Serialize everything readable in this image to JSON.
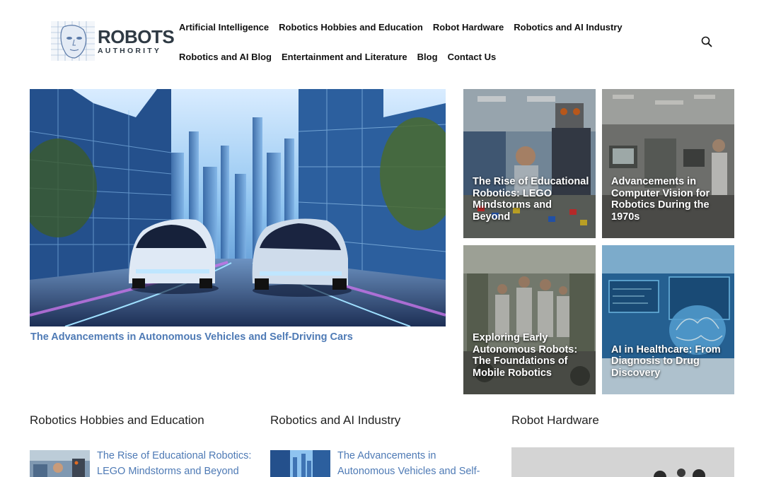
{
  "logo": {
    "title": "ROBOTS",
    "subtitle": "AUTHORITY"
  },
  "nav": {
    "row1": [
      "Artificial Intelligence",
      "Robotics Hobbies and Education",
      "Robot Hardware",
      "Robotics and AI Industry"
    ],
    "row2": [
      "Robotics and AI Blog",
      "Entertainment and Literature",
      "Blog",
      "Contact Us"
    ]
  },
  "icons": {
    "search": "search-icon"
  },
  "hero": {
    "title": "The Advancements in Autonomous Vehicles and Self-Driving Cars"
  },
  "tiles": [
    {
      "title": "The Rise of Educational Robotics: LEGO Mindstorms and Beyond"
    },
    {
      "title": "Advancements in Computer Vision for Robotics During the 1970s"
    },
    {
      "title": "Exploring Early Autonomous Robots: The Foundations of Mobile Robotics"
    },
    {
      "title": "AI in Healthcare: From Diagnosis to Drug Discovery"
    }
  ],
  "sections": [
    {
      "title": "Robotics Hobbies and Education",
      "link": "The Rise of Educational Robotics: LEGO Mindstorms and Beyond"
    },
    {
      "title": "Robotics and AI Industry",
      "link": "The Advancements in Autonomous Vehicles and Self-"
    },
    {
      "title": "Robot Hardware"
    }
  ],
  "colors": {
    "link": "#4e7ab5",
    "nav_text": "#111111",
    "logo_text": "#2f3a44"
  }
}
